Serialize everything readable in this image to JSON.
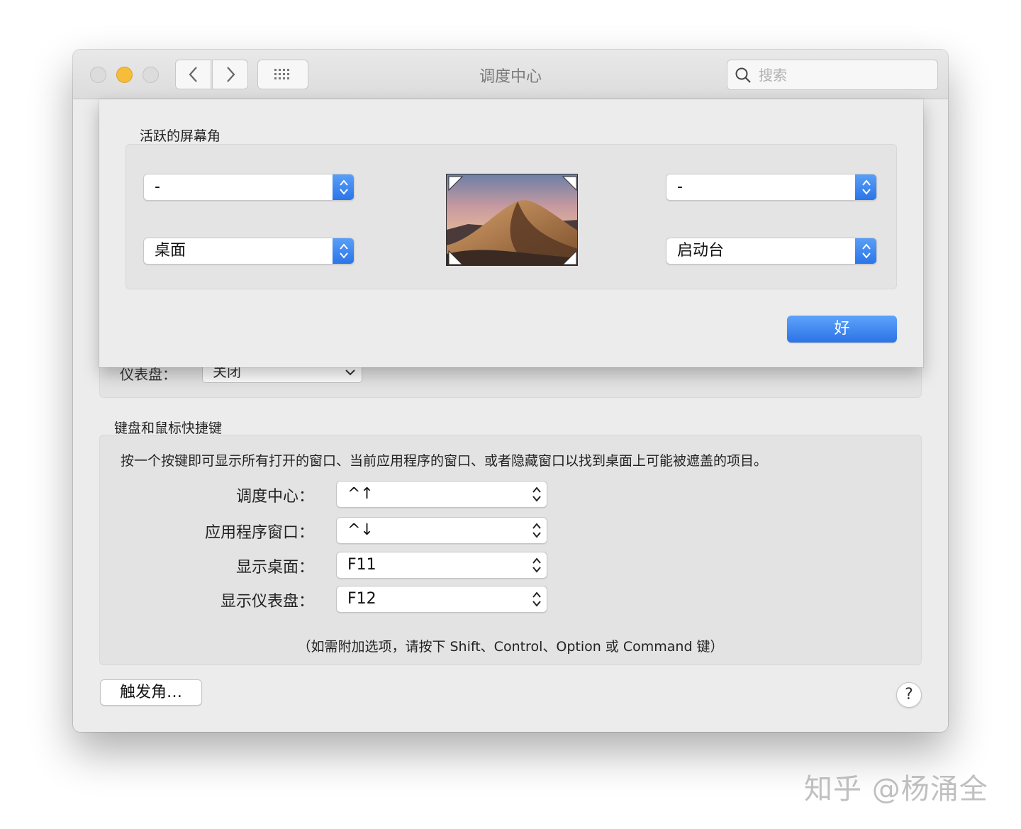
{
  "window": {
    "title": "调度中心",
    "search_placeholder": "搜索"
  },
  "dashboard": {
    "label": "仪表盘：",
    "value": "关闭"
  },
  "shortcuts": {
    "section_title": "键盘和鼠标快捷键",
    "description": "按一个按键即可显示所有打开的窗口、当前应用程序的窗口、或者隐藏窗口以找到桌面上可能被遮盖的项目。",
    "rows": [
      {
        "label": "调度中心：",
        "value": "^↑"
      },
      {
        "label": "应用程序窗口：",
        "value": "^↓"
      },
      {
        "label": "显示桌面：",
        "value": "F11"
      },
      {
        "label": "显示仪表盘：",
        "value": "F12"
      }
    ],
    "note": "（如需附加选项，请按下 Shift、Control、Option 或 Command 键）"
  },
  "buttons": {
    "hot_corners": "触发角…",
    "help": "?"
  },
  "sheet": {
    "title": "活跃的屏幕角",
    "corners": {
      "top_left": "-",
      "top_right": "-",
      "bottom_left": "桌面",
      "bottom_right": "启动台"
    },
    "ok": "好"
  },
  "watermark": "知乎 @杨涌全"
}
